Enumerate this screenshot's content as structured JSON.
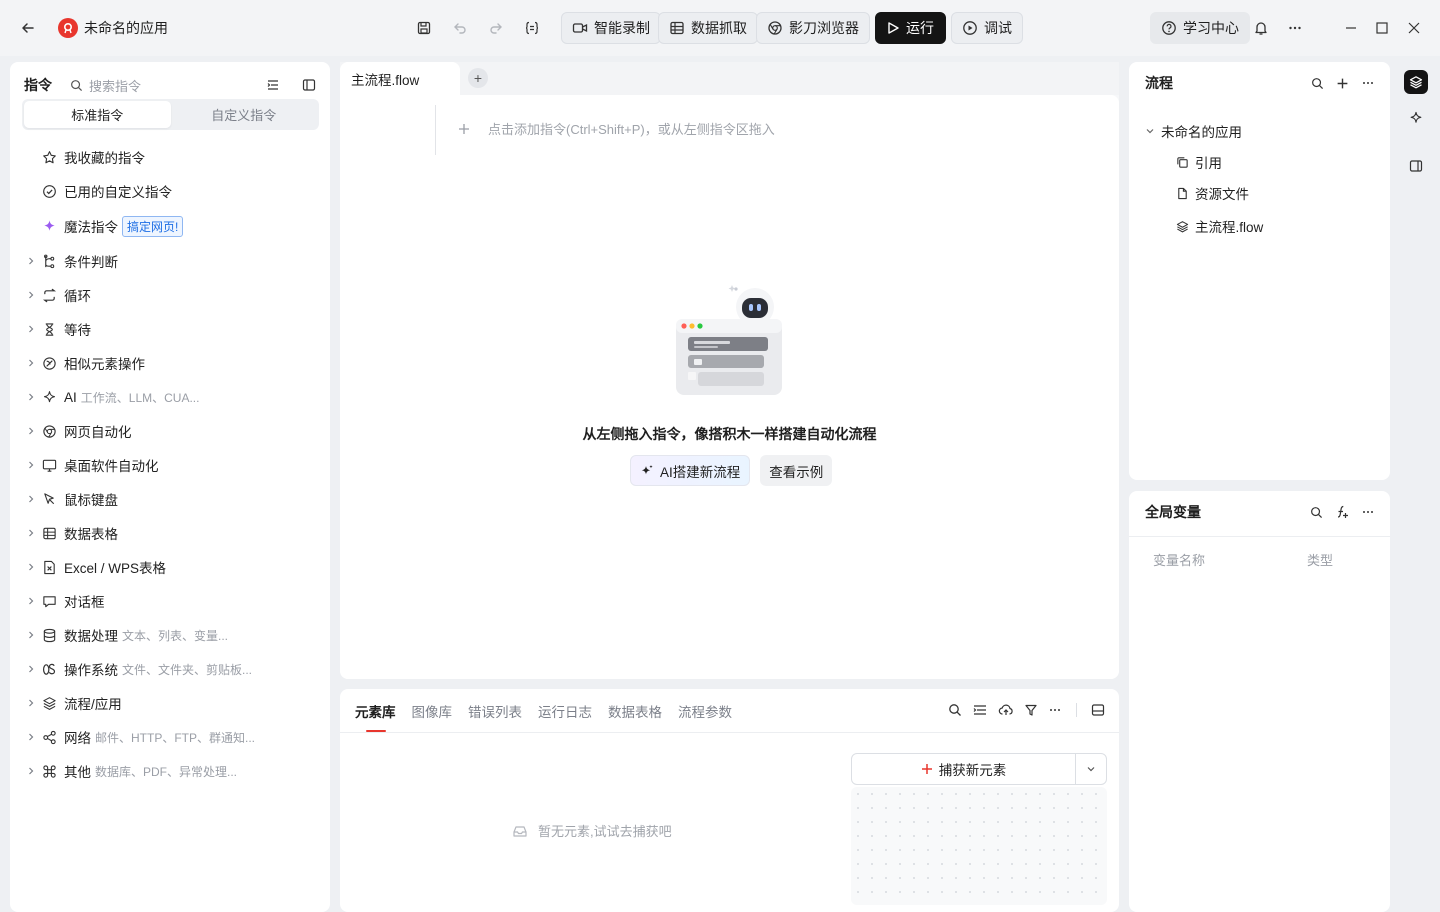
{
  "titlebar": {
    "app_title": "未命名的应用",
    "buttons": {
      "record": "智能录制",
      "scrape": "数据抓取",
      "browser": "影刀浏览器",
      "run": "运行",
      "debug": "调试",
      "learn": "学习中心"
    }
  },
  "left": {
    "title": "指令",
    "search_placeholder": "搜索指令",
    "seg_standard": "标准指令",
    "seg_custom": "自定义指令",
    "fav": "我收藏的指令",
    "used_custom": "已用的自定义指令",
    "magic": "魔法指令",
    "magic_badge": "搞定网页!",
    "groups": [
      {
        "label": "条件判断",
        "sub": ""
      },
      {
        "label": "循环",
        "sub": ""
      },
      {
        "label": "等待",
        "sub": ""
      },
      {
        "label": "相似元素操作",
        "sub": ""
      },
      {
        "label": "AI",
        "sub": "工作流、LLM、CUA..."
      },
      {
        "label": "网页自动化",
        "sub": ""
      },
      {
        "label": "桌面软件自动化",
        "sub": ""
      },
      {
        "label": "鼠标键盘",
        "sub": ""
      },
      {
        "label": "数据表格",
        "sub": ""
      },
      {
        "label": "Excel / WPS表格",
        "sub": ""
      },
      {
        "label": "对话框",
        "sub": ""
      },
      {
        "label": "数据处理",
        "sub": "文本、列表、变量..."
      },
      {
        "label": "操作系统",
        "sub": "文件、文件夹、剪贴板..."
      },
      {
        "label": "流程/应用",
        "sub": ""
      },
      {
        "label": "网络",
        "sub": "邮件、HTTP、FTP、群通知..."
      },
      {
        "label": "其他",
        "sub": "数据库、PDF、异常处理..."
      }
    ]
  },
  "editor": {
    "tab": "主流程.flow",
    "add_tab": "+",
    "hint": "点击添加指令(Ctrl+Shift+P)，或从左侧指令区拖入",
    "empty_title": "从左侧拖入指令，像搭积木一样搭建自动化流程",
    "ai_button": "AI搭建新流程",
    "example_button": "查看示例"
  },
  "bottom": {
    "tabs": [
      "元素库",
      "图像库",
      "错误列表",
      "运行日志",
      "数据表格",
      "流程参数"
    ],
    "empty": "暂无元素,试试去捕获吧",
    "capture": "捕获新元素"
  },
  "flow": {
    "title": "流程",
    "root": "未命名的应用",
    "children": [
      "引用",
      "资源文件",
      "主流程.flow"
    ]
  },
  "vars": {
    "title": "全局变量",
    "col_name": "变量名称",
    "col_type": "类型"
  }
}
